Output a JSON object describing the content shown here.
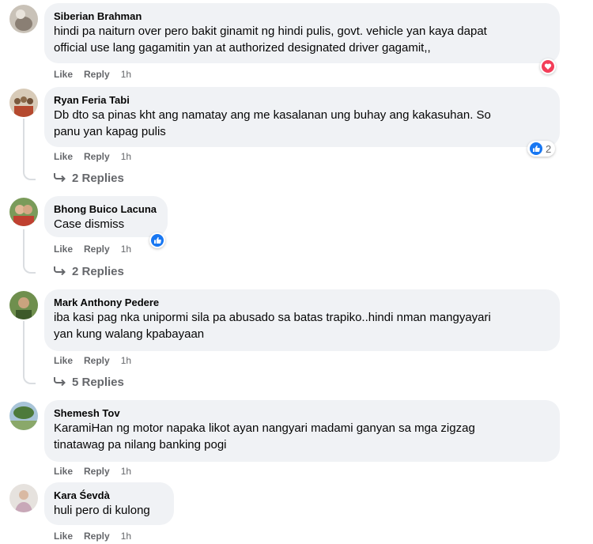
{
  "actions": {
    "like": "Like",
    "reply": "Reply"
  },
  "comments": [
    {
      "author": "Siberian Brahman",
      "lines": [
        "hindi pa naiturn over pero bakit ginamit ng hindi pulis, govt. vehicle yan kaya dapat",
        "official use lang gagamitin yan at authorized designated driver gagamit,,"
      ],
      "time": "1h",
      "reaction": {
        "icon": "heart-reaction-icon",
        "color": "#f33e58",
        "count": ""
      }
    },
    {
      "author": "Ryan Feria Tabi",
      "lines": [
        "Db dto sa pinas kht ang namatay ang me kasalanan ung buhay ang kakasuhan. So",
        "panu yan kapag pulis"
      ],
      "time": "1h",
      "reaction": {
        "icon": "like-reaction-icon",
        "color": "#1877f2",
        "count": "2"
      },
      "replies": "2 Replies"
    },
    {
      "author": "Bhong Buico Lacuna",
      "lines": [
        "Case dismiss"
      ],
      "time": "1h",
      "reaction": {
        "icon": "like-reaction-icon",
        "color": "#1877f2",
        "count": ""
      },
      "replies": "2 Replies"
    },
    {
      "author": "Mark Anthony Pedere",
      "lines": [
        "iba kasi pag nka unipormi sila pa abusado sa batas trapiko..hindi nman mangyayari",
        "yan kung walang kpabayaan"
      ],
      "time": "1h",
      "replies": "5 Replies"
    },
    {
      "author": "Shemesh Tov",
      "lines": [
        "KaramiHan ng motor napaka likot ayan nangyari madami ganyan sa mga zigzag",
        "tinatawag pa nilang banking pogi"
      ],
      "time": "1h"
    },
    {
      "author": "Kara Śevdà",
      "lines": [
        "huli pero di kulong"
      ],
      "time": "1h"
    }
  ]
}
